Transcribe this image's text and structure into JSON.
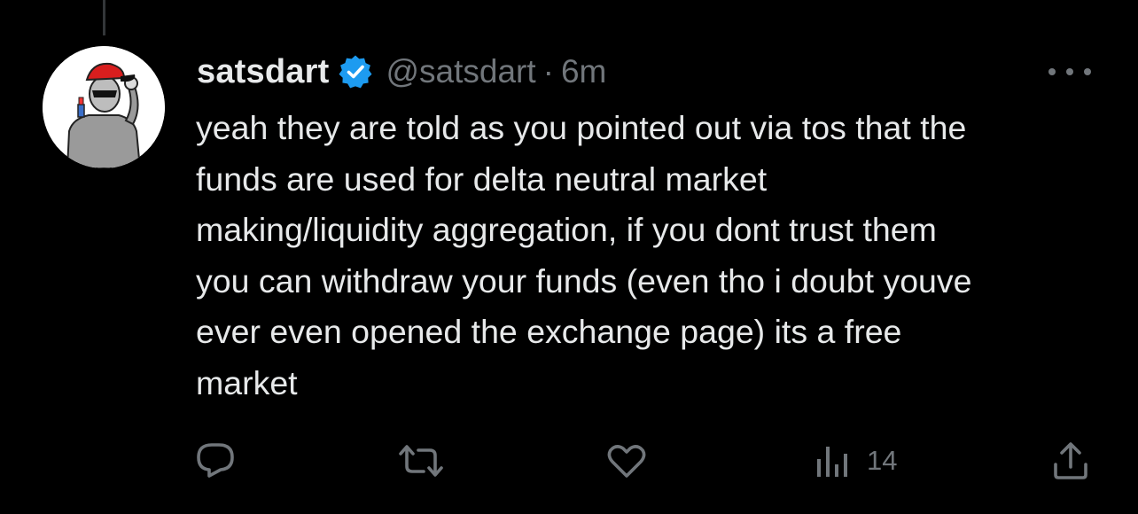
{
  "tweet": {
    "display_name": "satsdart",
    "verified": true,
    "handle": "@satsdart",
    "separator": "·",
    "time": "6m",
    "text": "yeah they are told as you pointed out via tos that the\nfunds are used for delta neutral market\nmaking/liquidity aggregation, if you dont trust them\nyou can withdraw your funds (even tho i doubt youve\never even opened the exchange page) its a free\nmarket"
  },
  "actions": {
    "reply_icon": "reply-icon",
    "retweet_icon": "retweet-icon",
    "like_icon": "heart-icon",
    "views_icon": "views-icon",
    "views_count": "14",
    "share_icon": "share-icon"
  },
  "colors": {
    "background": "#000000",
    "text": "#e7e9ea",
    "secondary": "#71767b",
    "verified": "#1d9bf0",
    "thread_line": "#333639"
  }
}
